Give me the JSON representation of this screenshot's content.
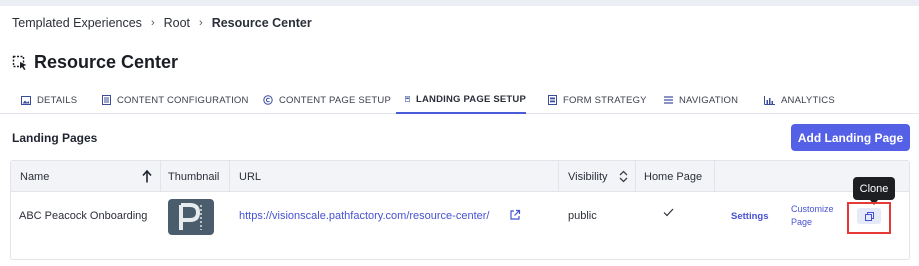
{
  "breadcrumb": {
    "items": [
      "Templated Experiences",
      "Root"
    ],
    "current": "Resource Center"
  },
  "page": {
    "title": "Resource Center"
  },
  "tabs": [
    {
      "label": "DETAILS",
      "icon": "image-icon"
    },
    {
      "label": "CONTENT CONFIGURATION",
      "icon": "document-icon"
    },
    {
      "label": "CONTENT PAGE SETUP",
      "icon": "copyright-icon"
    },
    {
      "label": "LANDING PAGE SETUP",
      "icon": "page-icon",
      "active": true
    },
    {
      "label": "FORM STRATEGY",
      "icon": "form-icon"
    },
    {
      "label": "NAVIGATION",
      "icon": "menu-icon"
    },
    {
      "label": "ANALYTICS",
      "icon": "bar-chart-icon"
    }
  ],
  "section": {
    "title": "Landing Pages",
    "add_button": "Add Landing Page"
  },
  "table": {
    "columns": [
      "Name",
      "Thumbnail",
      "URL",
      "Visibility",
      "Home Page"
    ],
    "rows": [
      {
        "name": "ABC Peacock Onboarding",
        "url": "https://visionscale.pathfactory.com/resource-center/",
        "visibility": "public",
        "home_page_icon": "checkmark-icon",
        "settings": "Settings",
        "customize_line1": "Customize",
        "customize_line2": "Page"
      }
    ]
  },
  "tooltip": "Clone",
  "colors": {
    "accent": "#5460e6",
    "link": "#4652d3",
    "highlight": "#e53935",
    "thumbnail_bg": "#4b5d6c"
  }
}
